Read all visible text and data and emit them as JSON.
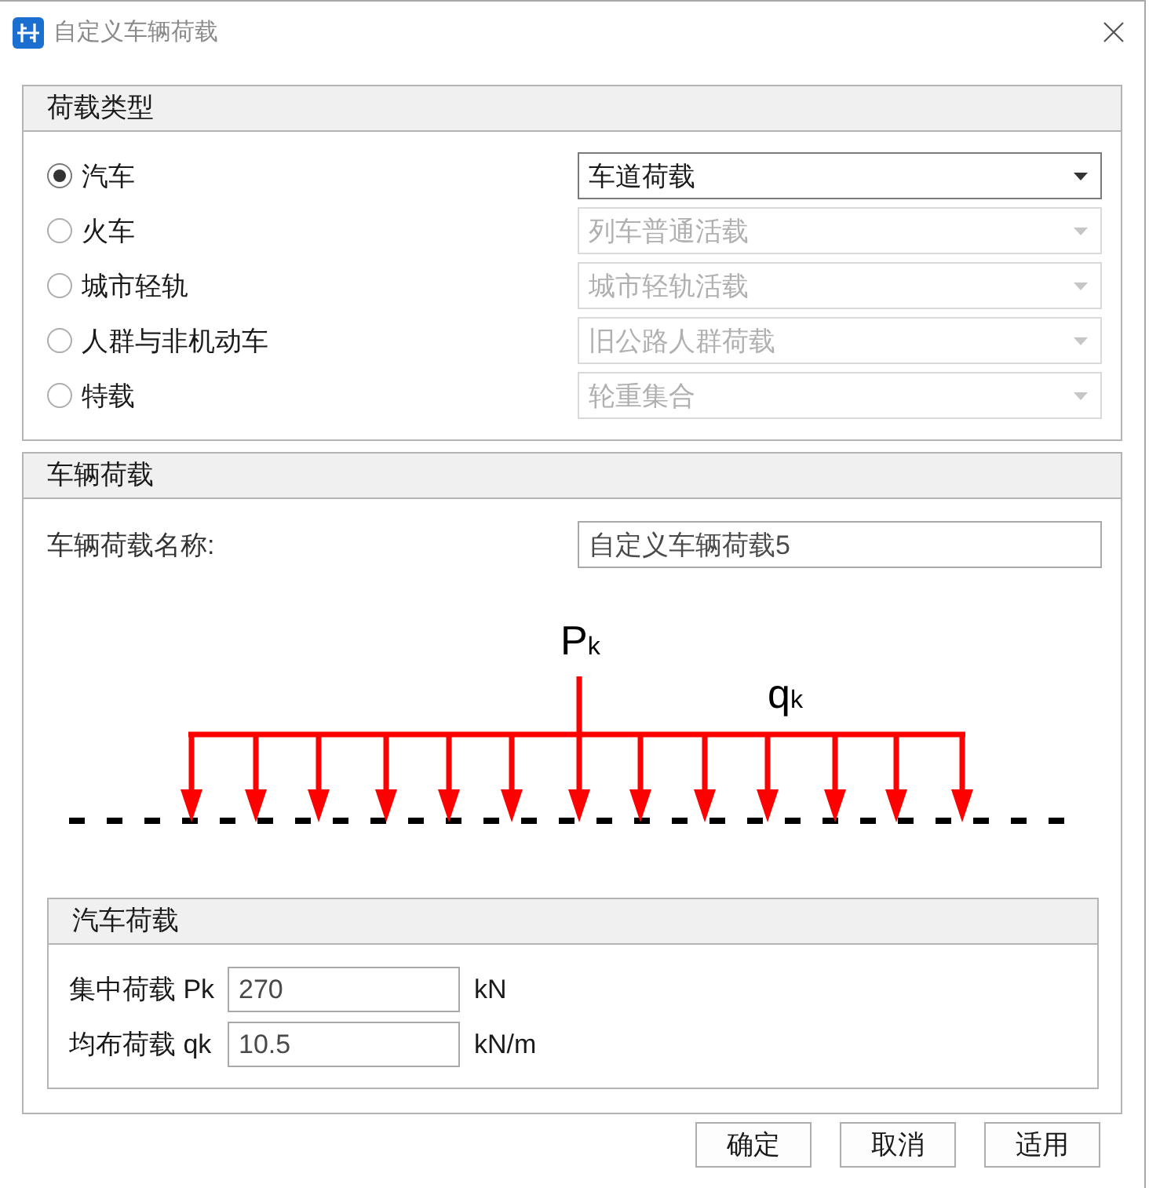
{
  "window": {
    "title": "自定义车辆荷载"
  },
  "load_type": {
    "title": "荷载类型",
    "options": [
      {
        "label": "汽车",
        "selected": true,
        "dropdown": {
          "value": "车道荷载",
          "disabled": false
        }
      },
      {
        "label": "火车",
        "selected": false,
        "dropdown": {
          "value": "列车普通活载",
          "disabled": true
        }
      },
      {
        "label": "城市轻轨",
        "selected": false,
        "dropdown": {
          "value": "城市轻轨活载",
          "disabled": true
        }
      },
      {
        "label": "人群与非机动车",
        "selected": false,
        "dropdown": {
          "value": "旧公路人群荷载",
          "disabled": true
        }
      },
      {
        "label": "特载",
        "selected": false,
        "dropdown": {
          "value": "轮重集合",
          "disabled": true
        }
      }
    ]
  },
  "vehicle_load": {
    "title": "车辆荷载",
    "name_field": {
      "label": "车辆荷载名称:",
      "value": "自定义车辆荷载5"
    },
    "diagram": {
      "point_load_label": "P$_{k}$",
      "distributed_load_label": "q$_{k}$"
    },
    "car_load": {
      "title": "汽车荷载",
      "fields": [
        {
          "label": "集中荷载 Pk",
          "value": "270",
          "unit": "kN"
        },
        {
          "label": "均布荷载 qk",
          "value": "10.5",
          "unit": "kN/m"
        }
      ]
    }
  },
  "buttons": [
    "确定",
    "取消",
    "适用"
  ]
}
